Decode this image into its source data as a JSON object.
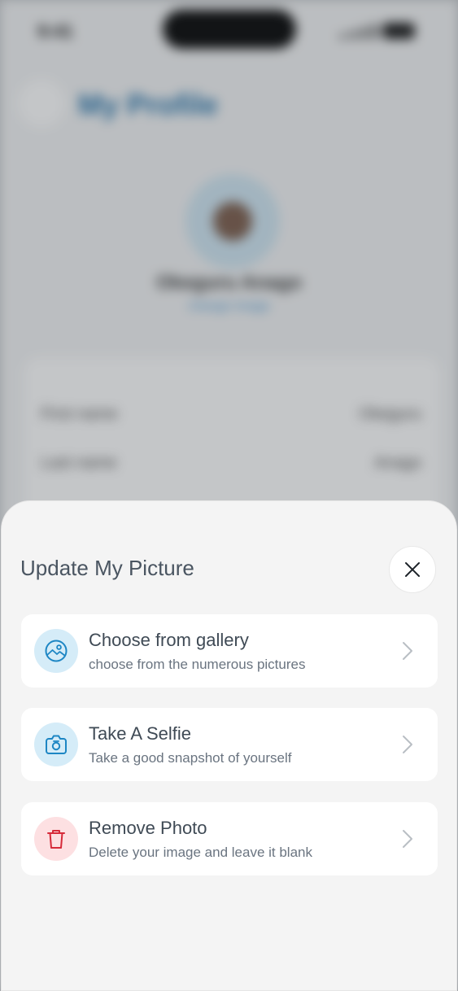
{
  "background": {
    "status_time": "9:41",
    "page_title": "My Profile",
    "profile_name": "Okeguru Anago",
    "change_image_label": "change image",
    "info_rows": [
      {
        "label": "First name",
        "value": "Okeguru"
      },
      {
        "label": "Last name",
        "value": "Anago"
      }
    ]
  },
  "sheet": {
    "title": "Update My Picture",
    "close_icon": "close-icon",
    "options": [
      {
        "title": "Choose from gallery",
        "subtitle": "choose from the numerous pictures",
        "icon": "gallery-icon",
        "tone": "#1d86c4"
      },
      {
        "title": "Take A Selfie",
        "subtitle": "Take a good snapshot of yourself",
        "icon": "camera-icon",
        "tone": "#1d86c4"
      },
      {
        "title": "Remove Photo",
        "subtitle": "Delete your image and leave it blank",
        "icon": "trash-icon",
        "tone": "#d62b3a"
      }
    ]
  },
  "colors": {
    "sheet_bg": "#f4f4f4",
    "card_bg": "#ffffff",
    "accent_blue": "#1d86c4",
    "accent_red": "#d62b3a",
    "text_primary": "#3f4a55"
  }
}
